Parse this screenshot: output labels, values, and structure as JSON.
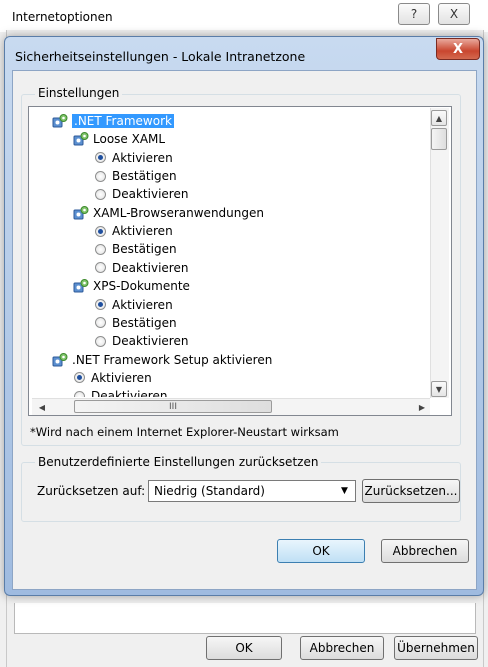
{
  "parent_window": {
    "title": "Internetoptionen",
    "help_glyph": "?",
    "close_glyph": "X",
    "buttons": {
      "ok": "OK",
      "cancel": "Abbrechen",
      "apply": "Übernehmen"
    }
  },
  "dialog": {
    "title": "Sicherheitseinstellungen - Lokale Intranetzone",
    "close_glyph": "X",
    "settings_group_label": "Einstellungen",
    "tree": [
      {
        "type": "category",
        "label": ".NET Framework",
        "selected": true
      },
      {
        "type": "subcategory",
        "label": "Loose XAML"
      },
      {
        "type": "option",
        "label": "Aktivieren",
        "checked": true
      },
      {
        "type": "option",
        "label": "Bestätigen",
        "checked": false
      },
      {
        "type": "option",
        "label": "Deaktivieren",
        "checked": false
      },
      {
        "type": "subcategory",
        "label": "XAML-Browseranwendungen"
      },
      {
        "type": "option",
        "label": "Aktivieren",
        "checked": true
      },
      {
        "type": "option",
        "label": "Bestätigen",
        "checked": false
      },
      {
        "type": "option",
        "label": "Deaktivieren",
        "checked": false
      },
      {
        "type": "subcategory",
        "label": "XPS-Dokumente"
      },
      {
        "type": "option",
        "label": "Aktivieren",
        "checked": true
      },
      {
        "type": "option",
        "label": "Bestätigen",
        "checked": false
      },
      {
        "type": "option",
        "label": "Deaktivieren",
        "checked": false
      },
      {
        "type": "category",
        "label": ".NET Framework Setup aktivieren",
        "selected": false
      },
      {
        "type": "option",
        "label": "Aktivieren",
        "checked": true
      },
      {
        "type": "option",
        "label": "Deaktivieren",
        "checked": false
      }
    ],
    "hscroll_thumb_glyph": "III",
    "note": "*Wird nach einem Internet Explorer-Neustart wirksam",
    "reset_group_label": "Benutzerdefinierte Einstellungen zurücksetzen",
    "reset_to_label": "Zurücksetzen auf:",
    "reset_level_value": "Niedrig (Standard)",
    "reset_button": "Zurücksetzen...",
    "ok_button": "OK",
    "cancel_button": "Abbrechen"
  }
}
